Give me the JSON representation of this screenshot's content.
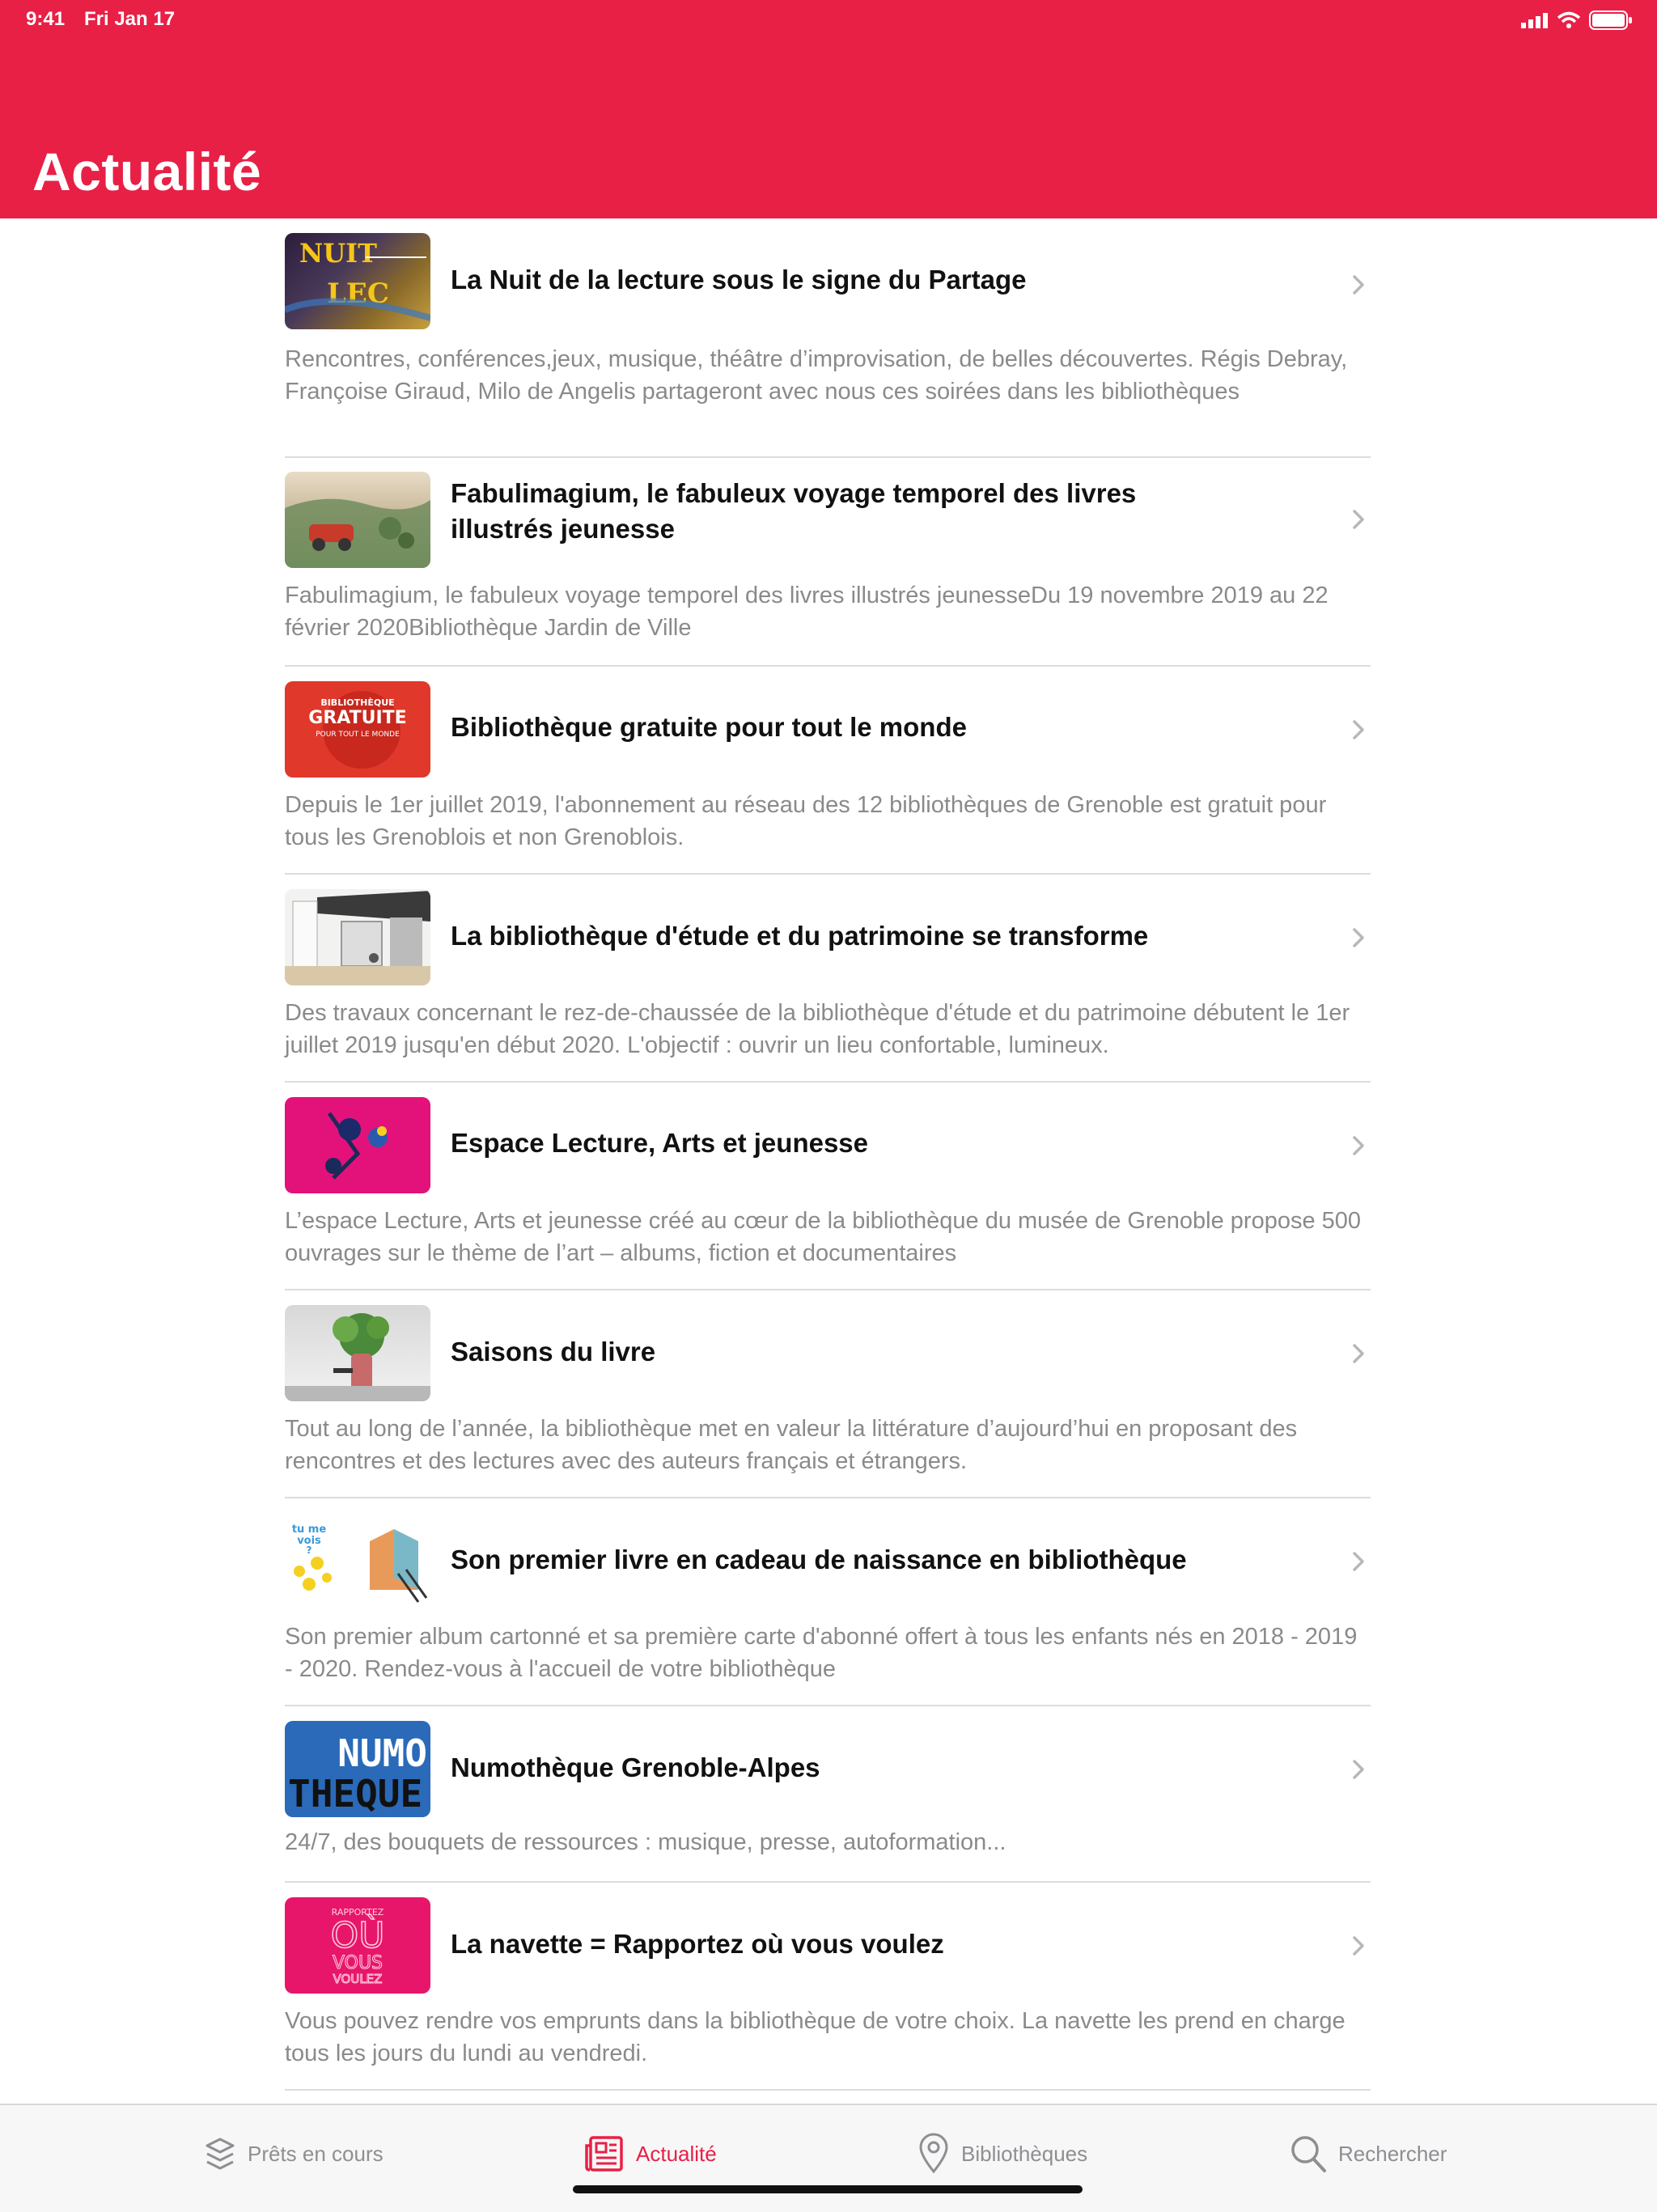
{
  "status_bar": {
    "time": "9:41",
    "date": "Fri Jan 17"
  },
  "header": {
    "title": "Actualité"
  },
  "colors": {
    "accent": "#e82046",
    "text": "#111111",
    "secondary": "#8a8a8a",
    "separator": "#dcdcdc"
  },
  "news": [
    {
      "title": "La Nuit de la lecture sous le signe du Partage",
      "desc": "Rencontres, conférences,jeux, musique, théâtre d’improvisation, de belles découvertes. Régis Debray, Françoise Giraud, Milo de Angelis partageront avec nous ces soirées dans les bibliothèques",
      "thumb_text": [
        "NUIT",
        "LEC"
      ]
    },
    {
      "title": "Fabulimagium, le fabuleux voyage temporel des livres illustrés jeunesse",
      "desc": "Fabulimagium, le fabuleux voyage temporel des livres illustrés jeunesseDu 19 novembre 2019 au 22 février 2020Bibliothèque Jardin de Ville",
      "thumb_text": []
    },
    {
      "title": "Bibliothèque gratuite pour tout le monde",
      "desc": "Depuis le 1er juillet 2019, l'abonnement au réseau des 12 bibliothèques de Grenoble est gratuit pour tous les Grenoblois et non Grenoblois.",
      "thumb_text": [
        "BIBLIOTHÈQUE",
        "GRATUITE",
        "POUR TOUT LE MONDE"
      ]
    },
    {
      "title": "La bibliothèque d'étude et du patrimoine se transforme",
      "desc": "Des travaux concernant le rez-de-chaussée de la bibliothèque d'étude et du patrimoine débutent le 1er juillet 2019 jusqu'en début 2020. L'objectif : ouvrir un lieu confortable, lumineux.",
      "thumb_text": []
    },
    {
      "title": "Espace Lecture, Arts et jeunesse",
      "desc": "L’espace Lecture, Arts et jeunesse créé au cœur de la bibliothèque du musée de Grenoble propose 500 ouvrages sur le thème de l’art – albums, fiction et documentaires",
      "thumb_text": []
    },
    {
      "title": "Saisons du livre",
      "desc": "Tout au long de l’année, la bibliothèque met en valeur la littérature d’aujourd’hui en proposant des rencontres et des lectures avec des auteurs français et étrangers.",
      "thumb_text": []
    },
    {
      "title": "Son premier livre en cadeau de naissance en bibliothèque",
      "desc": "Son premier album cartonné et sa première carte d'abonné offert à tous les enfants nés en 2018 - 2019 - 2020. Rendez-vous à l'accueil de votre bibliothèque",
      "thumb_text": [
        "tu me",
        "vois",
        "?"
      ]
    },
    {
      "title": "Numothèque Grenoble-Alpes",
      "desc": "24/7, des bouquets de ressources : musique, presse, autoformation...",
      "thumb_text": [
        "NUMO",
        "THEQUE"
      ]
    },
    {
      "title": "La navette = Rapportez où vous voulez",
      "desc": "Vous pouvez rendre vos emprunts dans la bibliothèque de votre choix. La navette les prend en charge tous les jours du lundi au vendredi.",
      "thumb_text": [
        "RAPPORTEZ",
        "OÙ",
        "VOUS",
        "VOULEZ"
      ]
    }
  ],
  "tabbar": {
    "tabs": [
      {
        "label": "Prêts en cours",
        "icon": "stack-icon"
      },
      {
        "label": "Actualité",
        "icon": "newspaper-icon",
        "active": true
      },
      {
        "label": "Bibliothèques",
        "icon": "location-pin-icon"
      },
      {
        "label": "Rechercher",
        "icon": "search-icon"
      }
    ]
  }
}
